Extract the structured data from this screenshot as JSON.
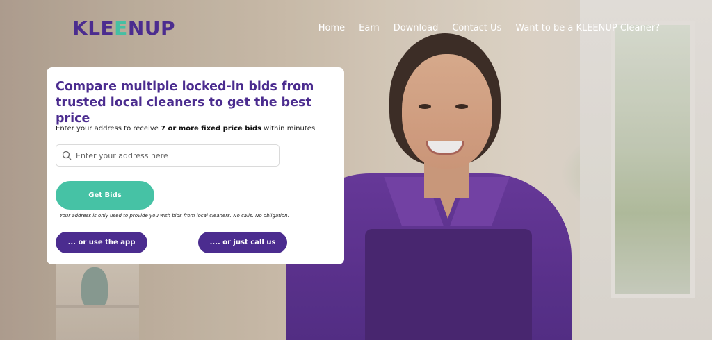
{
  "header": {
    "logo_prefix": "KLE",
    "logo_accent": "E",
    "logo_suffix": "NUP",
    "nav": [
      {
        "label": "Home"
      },
      {
        "label": "Earn"
      },
      {
        "label": "Download"
      },
      {
        "label": "Contact Us"
      },
      {
        "label": "Want to be a KLEENUP Cleaner?"
      }
    ]
  },
  "card": {
    "title": "Compare multiple locked-in bids from trusted local cleaners to get the best price",
    "subtitle_prefix": "Enter your address to receive ",
    "subtitle_bold": "7 or more fixed price bids",
    "subtitle_suffix": " within minutes",
    "search_placeholder": "Enter your address here",
    "search_icon": "search-icon",
    "get_bids_label": "Get Bids",
    "note": "Your address is only used to provide you with bids from local cleaners. No calls. No obligation.",
    "app_button_label": "... or use the app",
    "call_button_label": ".... or just call us"
  },
  "colors": {
    "brand_purple": "#4b2c8f",
    "brand_teal": "#46c2a5"
  }
}
